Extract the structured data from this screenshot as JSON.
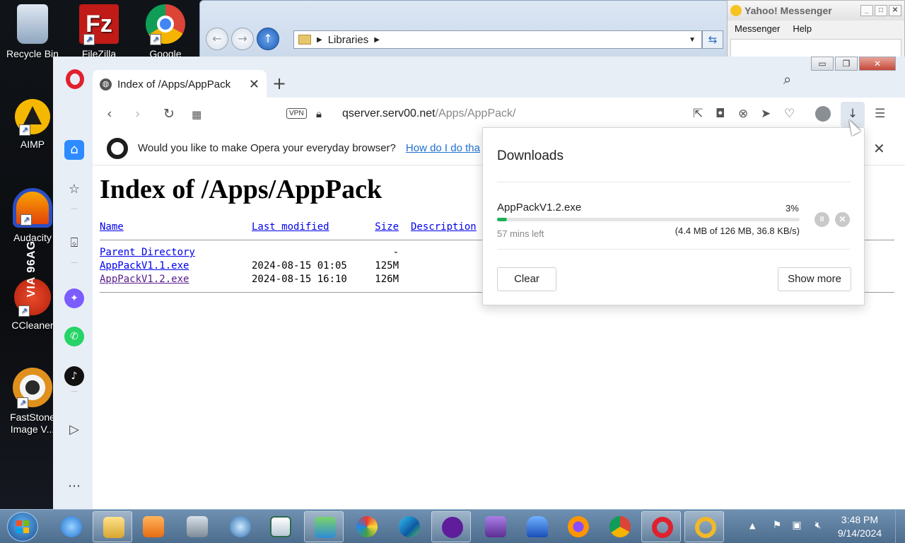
{
  "desktop": {
    "icons": [
      {
        "label": "Recycle Bin"
      },
      {
        "label": "FileZilla"
      },
      {
        "label": "Google"
      },
      {
        "label": "AIMP"
      },
      {
        "label": "Audacity"
      },
      {
        "label": "CCleaner"
      },
      {
        "label": "FastStone Image V..."
      }
    ],
    "side_text": "VIA 96AG"
  },
  "explorer": {
    "address": "Libraries"
  },
  "yahoo": {
    "title": "Yahoo! Messenger",
    "menu": [
      "Messenger",
      "Help"
    ]
  },
  "browser": {
    "tab_title": "Index of /Apps/AppPack",
    "vpn_label": "VPN",
    "url_host": "qserver.serv00.net",
    "url_path": "/Apps/AppPack/",
    "infobar": {
      "text": "Would you like to make Opera your everyday browser?",
      "link": "How do I do tha"
    }
  },
  "page": {
    "heading": "Index of /Apps/AppPack",
    "columns": [
      "Name",
      "Last modified",
      "Size",
      "Description"
    ],
    "rows": [
      {
        "name": "Parent Directory",
        "modified": "",
        "size": "-"
      },
      {
        "name": "AppPackV1.1.exe",
        "modified": "2024-08-15 01:05",
        "size": "125M"
      },
      {
        "name": "AppPackV1.2.exe",
        "modified": "2024-08-15 16:10",
        "size": "126M"
      }
    ]
  },
  "downloads": {
    "title": "Downloads",
    "item": {
      "filename": "AppPackV1.2.exe",
      "percent": "3%",
      "progress": 0.03,
      "time_left": "57 mins left",
      "size_status": "(4.4 MB of 126 MB, 36.8 KB/s)"
    },
    "clear_label": "Clear",
    "show_more_label": "Show more"
  },
  "taskbar": {
    "time": "3:48 PM",
    "date": "9/14/2024"
  },
  "colors": {
    "opera_red": "#e0212e",
    "progress_green": "#1bb15b",
    "link_blue": "#0000ee",
    "sidebar_home_blue": "#2e8bff"
  }
}
